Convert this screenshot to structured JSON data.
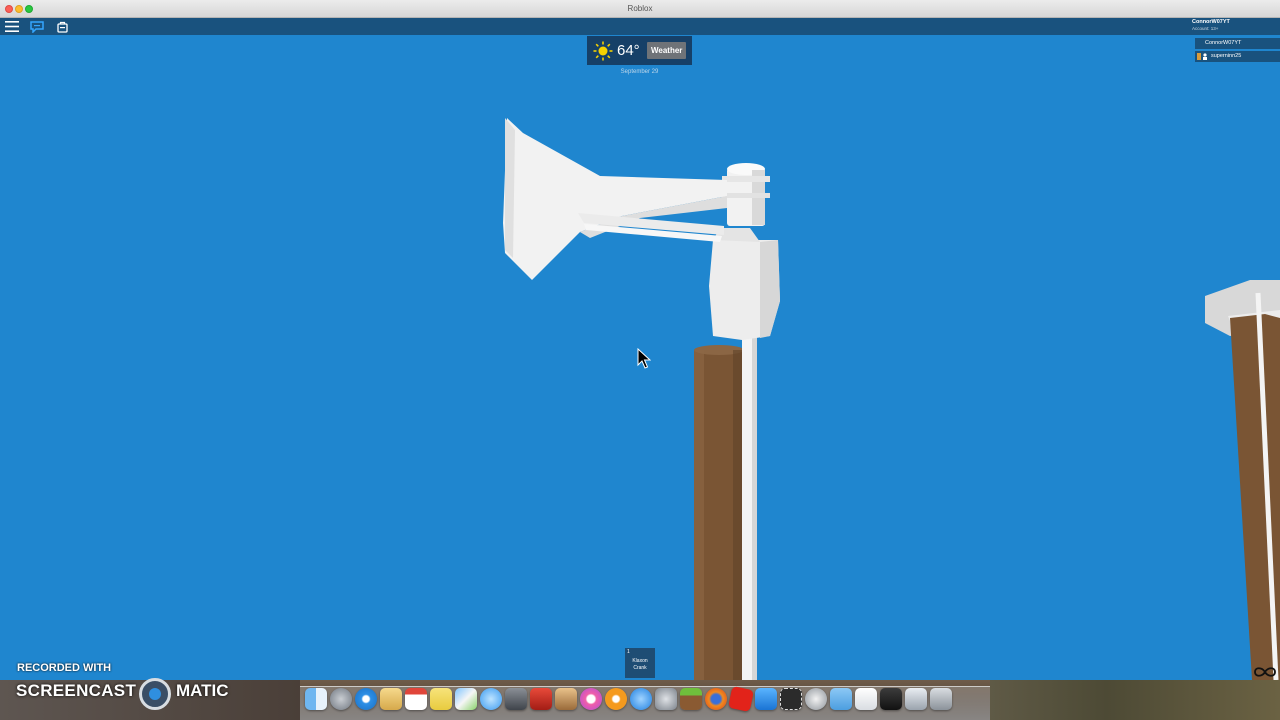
{
  "window": {
    "title": "Roblox"
  },
  "topbar": {
    "account_name": "ConnorW07YT",
    "account_sub": "Account: 13+",
    "players": [
      "ConnorW07YT",
      "superninn25"
    ]
  },
  "weather": {
    "temperature": "64°",
    "button_label": "Weather",
    "date": "September 29"
  },
  "hotbar": {
    "slot_number": "1",
    "slot_label_line1": "Klaxon",
    "slot_label_line2": "Crank"
  },
  "watermark": {
    "line1": "RECORDED WITH",
    "brand_left": "SCREENCAST",
    "brand_right": "MATIC"
  },
  "colors": {
    "sky": "#1f86cf",
    "pole_wood": "#7a5534",
    "siren_white": "#f2f2f2"
  },
  "dock": {
    "icons": [
      "finder-icon",
      "launchpad-icon",
      "safari-icon",
      "preview-icon",
      "calendar-icon",
      "notes-icon",
      "photos-icon",
      "messages-icon",
      "facetime-icon",
      "books-icon",
      "image-capture-icon",
      "itunes-icon",
      "ibooks-icon",
      "app-store-icon",
      "system-preferences-icon",
      "minecraft-icon",
      "firefox-icon",
      "roblox-icon",
      "xcode-icon",
      "screenshot-icon",
      "disk-utility-icon",
      "folder-icon",
      "document-icon",
      "terminal-icon",
      "bluetooth-icon",
      "trash-icon"
    ]
  }
}
